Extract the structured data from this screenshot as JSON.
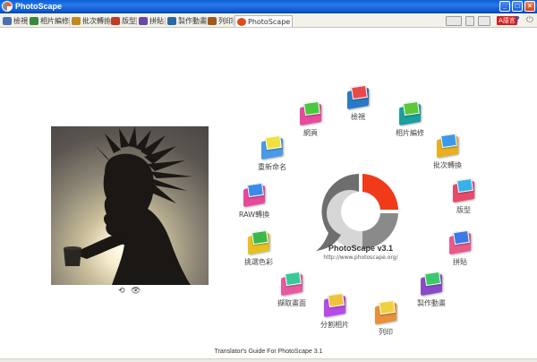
{
  "window": {
    "title": "PhotoScape",
    "controls": {
      "minimize": "_",
      "maximize": "□",
      "close": "×"
    }
  },
  "tabs": [
    {
      "label": "檢視",
      "icon": "viewer-icon",
      "color": "#4a6fb0"
    },
    {
      "label": "相片編修",
      "icon": "editor-icon",
      "color": "#3a8a3a"
    },
    {
      "label": "批次轉換",
      "icon": "batch-icon",
      "color": "#c08a20"
    },
    {
      "label": "版型",
      "icon": "page-icon",
      "color": "#c03a2a"
    },
    {
      "label": "拼貼",
      "icon": "combine-icon",
      "color": "#6a4aa0"
    },
    {
      "label": "製作動畫",
      "icon": "gif-icon",
      "color": "#2a6aa0"
    },
    {
      "label": "列印",
      "icon": "print-icon",
      "color": "#a05a20"
    },
    {
      "label": "PhotoScape",
      "icon": "home-icon",
      "color": "#e04a20",
      "active": true
    }
  ],
  "toolbar_right": {
    "language_badge": "A語言",
    "help_icon": "?",
    "exit_icon": "⏻"
  },
  "photo": {
    "controls": {
      "rotate": "⟲",
      "view": "👁"
    }
  },
  "menu": [
    {
      "label": "檢視",
      "color1": "#2a7ac8",
      "color2": "#e84a4a"
    },
    {
      "label": "相片編修",
      "color1": "#1aa0a0",
      "color2": "#5ac83a"
    },
    {
      "label": "批次轉換",
      "color1": "#e8b020",
      "color2": "#3a9ae8"
    },
    {
      "label": "版型",
      "color1": "#e84a6a",
      "color2": "#3ab0e8"
    },
    {
      "label": "拼貼",
      "color1": "#e85a8a",
      "color2": "#3a7ae8"
    },
    {
      "label": "製作動畫",
      "color1": "#8a4ac8",
      "color2": "#3ac86a"
    },
    {
      "label": "列印",
      "color1": "#e8903a",
      "color2": "#f0d040"
    },
    {
      "label": "分割相片",
      "color1": "#b84ae8",
      "color2": "#f0c040"
    },
    {
      "label": "擷取畫面",
      "color1": "#e85aa0",
      "color2": "#3ac89a"
    },
    {
      "label": "挑選色彩",
      "color1": "#e8c020",
      "color2": "#3ab84a"
    },
    {
      "label": "RAW轉換",
      "color1": "#e84a9a",
      "color2": "#3a8ae8"
    },
    {
      "label": "重新命名",
      "color1": "#4a9ae8",
      "color2": "#f0e040"
    },
    {
      "label": "網頁",
      "color1": "#e84aa0",
      "color2": "#4ac840"
    }
  ],
  "center": {
    "title": "PhotoScape v3.1",
    "url": "http://www.photoscape.org/",
    "colors": {
      "accent": "#f03a1a",
      "gray": "#7a7a7a",
      "light": "#c8c8c8"
    }
  },
  "footer": "Translator's Guide For PhotoScape 3.1"
}
